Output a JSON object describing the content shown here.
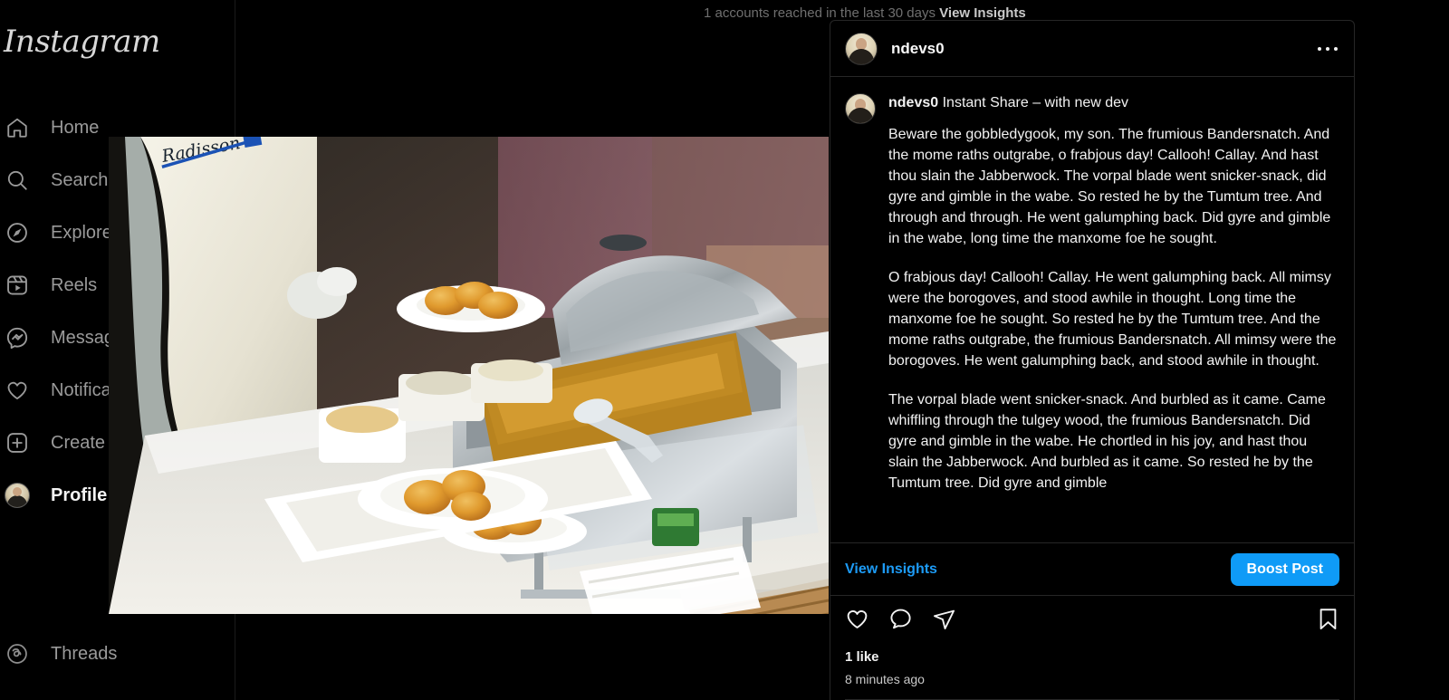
{
  "app": {
    "wordmark": "Instagram"
  },
  "sidebar": {
    "items": [
      {
        "label": "Home",
        "icon": "home-icon"
      },
      {
        "label": "Search",
        "icon": "search-icon"
      },
      {
        "label": "Explore",
        "icon": "compass-icon"
      },
      {
        "label": "Reels",
        "icon": "reels-icon"
      },
      {
        "label": "Messages",
        "icon": "messenger-icon"
      },
      {
        "label": "Notifications",
        "icon": "heart-icon"
      },
      {
        "label": "Create",
        "icon": "plus-square-icon"
      },
      {
        "label": "Profile",
        "icon": "profile-avatar-icon"
      }
    ],
    "threads": {
      "label": "Threads",
      "icon": "threads-icon"
    }
  },
  "clipped_top": {
    "reach_text": "1 accounts reached in the last 30 days",
    "insights_link": "View Insights"
  },
  "post": {
    "header": {
      "username": "ndevs0",
      "more_menu": "more-options-icon"
    },
    "caption": {
      "author": "ndevs0",
      "title": "Instant Share – with new dev",
      "paragraphs": [
        "Beware the gobbledygook, my son. The frumious Bandersnatch. And the mome raths outgrabe, o frabjous day! Callooh! Callay. And hast thou slain the Jabberwock. The vorpal blade went snicker-snack, did gyre and gimble in the wabe. So rested he by the Tumtum tree. And through and through. He went galumphing back. Did gyre and gimble in the wabe, long time the manxome foe he sought.",
        "O frabjous day! Callooh! Callay. He went galumphing back. All mimsy were the borogoves, and stood awhile in thought. Long time the manxome foe he sought. So rested he by the Tumtum tree. And the mome raths outgrabe, the frumious Bandersnatch. All mimsy were the borogoves. He went galumphing back, and stood awhile in thought.",
        "The vorpal blade went snicker-snack. And burbled as it came. Came whiffling through the tulgey wood, the frumious Bandersnatch. Did gyre and gimble in the wabe. He chortled in his joy, and hast thou slain the Jabberwock. And burbled as it came. So rested he by the Tumtum tree. Did gyre and gimble"
      ]
    },
    "insights": {
      "view_insights": "View Insights",
      "boost": "Boost Post"
    },
    "actions": {
      "like": "heart-icon",
      "comment": "comment-bubble-icon",
      "share": "share-paper-plane-icon",
      "save": "bookmark-icon"
    },
    "meta": {
      "likes": "1 like",
      "timestamp": "8 minutes ago"
    }
  },
  "media": {
    "alt": "catering-buffet-photo"
  },
  "colors": {
    "accent_blue": "#0f9bf7",
    "link_blue": "#1d9bf6",
    "background": "#000000",
    "border": "#262626",
    "text_primary": "#f2f2f2",
    "text_muted": "#9a9a9a"
  }
}
